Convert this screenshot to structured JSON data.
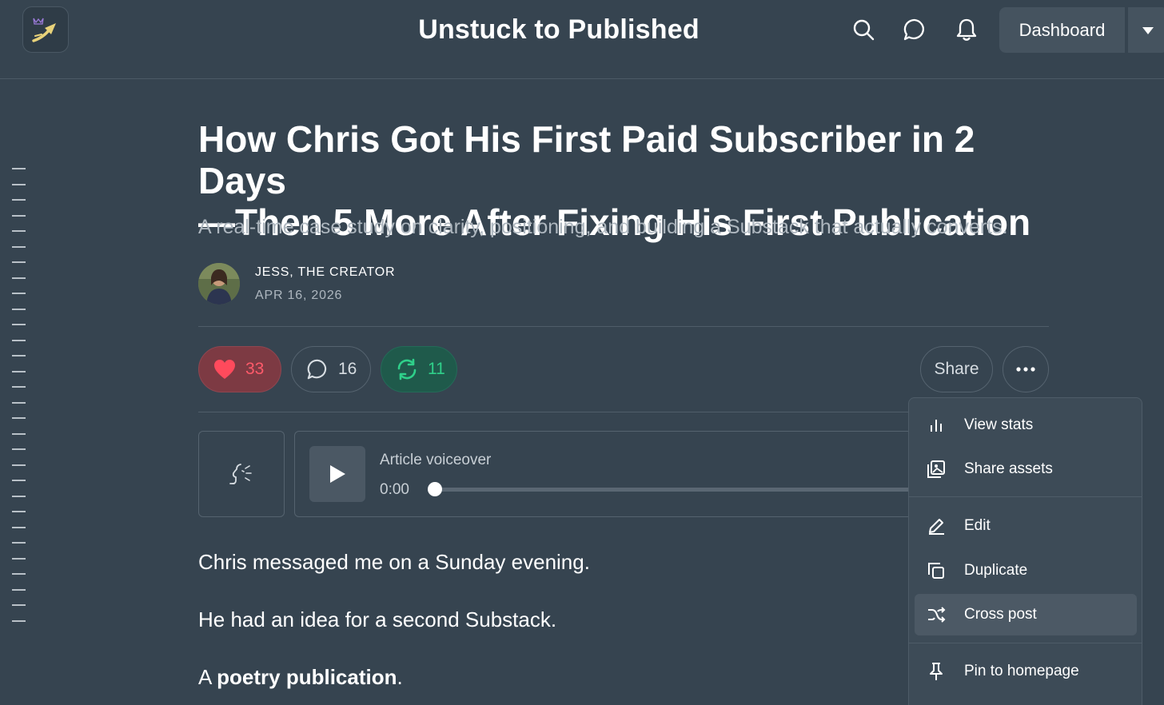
{
  "header": {
    "publication_title": "Unstuck to Published",
    "dashboard_label": "Dashboard",
    "icons": [
      "logo-icon",
      "search-icon",
      "chat-icon",
      "bell-icon",
      "chevron-down-icon"
    ]
  },
  "article": {
    "title_line1": "How Chris Got His First Paid Subscriber in 2 Days",
    "title_line2": "—Then 5 More After Fixing His First Publication",
    "subtitle": "A real-time case study on clarity, positioning, and building a Substack that actually converts.",
    "author": "JESS, THE CREATOR",
    "date": "APR 16, 2026"
  },
  "engagement": {
    "likes": "33",
    "comments": "16",
    "restacks": "11",
    "share_label": "Share",
    "colors": {
      "like": "#ff5a6a",
      "restack": "#2fd08a"
    }
  },
  "audio": {
    "label": "Article voiceover",
    "time": "0:00",
    "progress": 0
  },
  "body": {
    "p1": "Chris messaged me on a Sunday evening.",
    "p2": "He had an idea for a second Substack.",
    "p3_prefix": "A ",
    "p3_bold": "poetry publication",
    "p3_suffix": "."
  },
  "menu": {
    "items": [
      {
        "label": "View stats",
        "icon": "bar-chart-icon"
      },
      {
        "label": "Share assets",
        "icon": "image-icon"
      },
      {
        "label": "Edit",
        "icon": "pencil-icon"
      },
      {
        "label": "Duplicate",
        "icon": "copy-icon"
      },
      {
        "label": "Cross post",
        "icon": "shuffle-icon",
        "active": true
      },
      {
        "label": "Pin to homepage",
        "icon": "pin-icon"
      }
    ]
  }
}
